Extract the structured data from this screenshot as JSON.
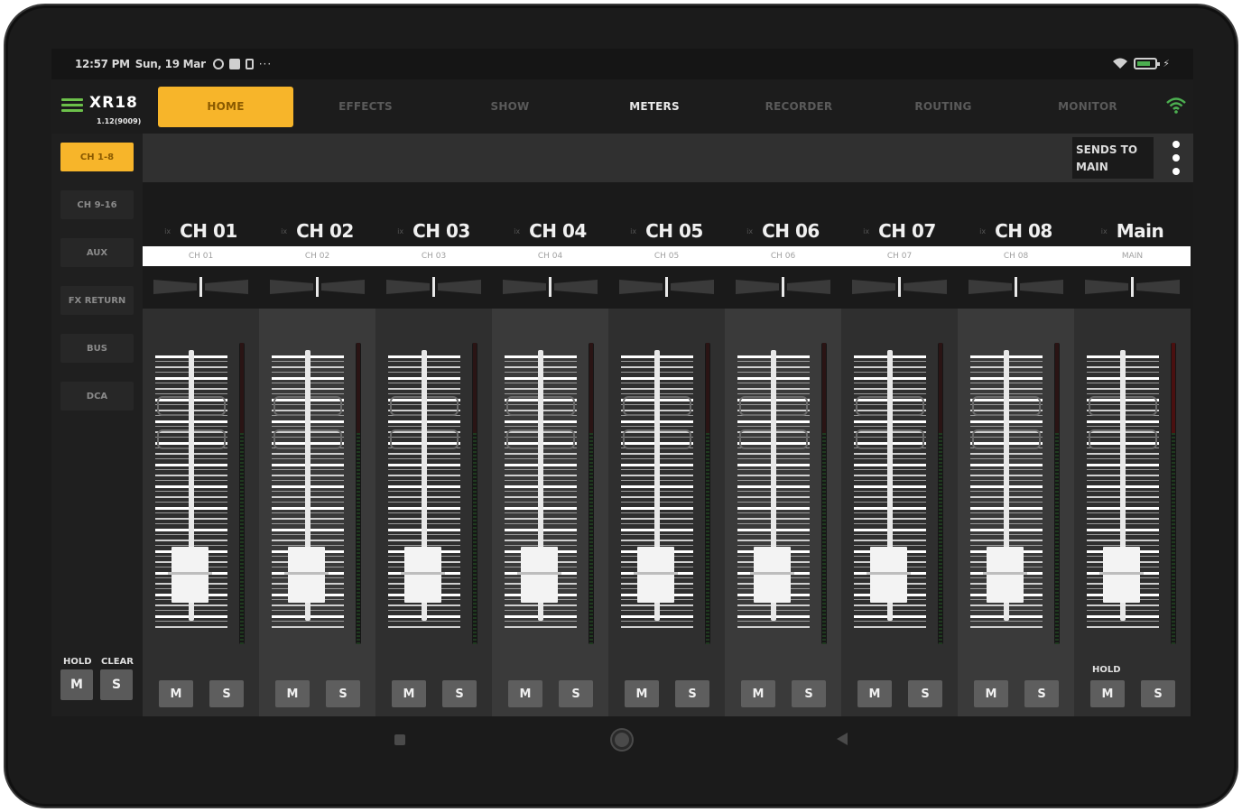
{
  "status_bar": {
    "time": "12:57 PM",
    "date": "Sun, 19 Mar",
    "more": "···"
  },
  "nav": {
    "logo": "XR18",
    "firmware": "1.12(9009)",
    "tabs": [
      "HOME",
      "EFFECTS",
      "SHOW",
      "METERS",
      "RECORDER",
      "ROUTING",
      "MONITOR"
    ],
    "active_tab": "HOME"
  },
  "sidebar": {
    "items": [
      "CH 1-8",
      "CH 9-16",
      "AUX",
      "FX RETURN",
      "BUS",
      "DCA"
    ],
    "active": "CH 1-8",
    "hold_label": "HOLD",
    "clear_label": "CLEAR",
    "hold_button": "M",
    "clear_button": "S"
  },
  "sends": {
    "line1": "SENDS TO",
    "line2": "MAIN"
  },
  "channels": [
    {
      "name": "CH 01",
      "sub": "CH 01",
      "ix": "ix",
      "mute": "M",
      "solo": "S",
      "level": 0.0
    },
    {
      "name": "CH 02",
      "sub": "CH 02",
      "ix": "ix",
      "mute": "M",
      "solo": "S",
      "level": 0.0
    },
    {
      "name": "CH 03",
      "sub": "CH 03",
      "ix": "ix",
      "mute": "M",
      "solo": "S",
      "level": 0.0
    },
    {
      "name": "CH 04",
      "sub": "CH 04",
      "ix": "ix",
      "mute": "M",
      "solo": "S",
      "level": 0.0
    },
    {
      "name": "CH 05",
      "sub": "CH 05",
      "ix": "ix",
      "mute": "M",
      "solo": "S",
      "level": 0.0
    },
    {
      "name": "CH 06",
      "sub": "CH 06",
      "ix": "ix",
      "mute": "M",
      "solo": "S",
      "level": 0.0
    },
    {
      "name": "CH 07",
      "sub": "CH 07",
      "ix": "ix",
      "mute": "M",
      "solo": "S",
      "level": 0.0
    },
    {
      "name": "CH 08",
      "sub": "CH 08",
      "ix": "ix",
      "mute": "M",
      "solo": "S",
      "level": 0.0
    },
    {
      "name": "Main",
      "sub": "MAIN",
      "ix": "ix",
      "mute": "M",
      "solo": "S",
      "level": 0.0,
      "hold": "HOLD"
    }
  ],
  "colors": {
    "accent": "#f7b52a",
    "wifi": "#4caf50"
  },
  "icons": {
    "menu": "hamburger-icon",
    "wifi": "wifi-icon",
    "battery": "battery-icon",
    "kebab": "kebab-menu-icon"
  }
}
